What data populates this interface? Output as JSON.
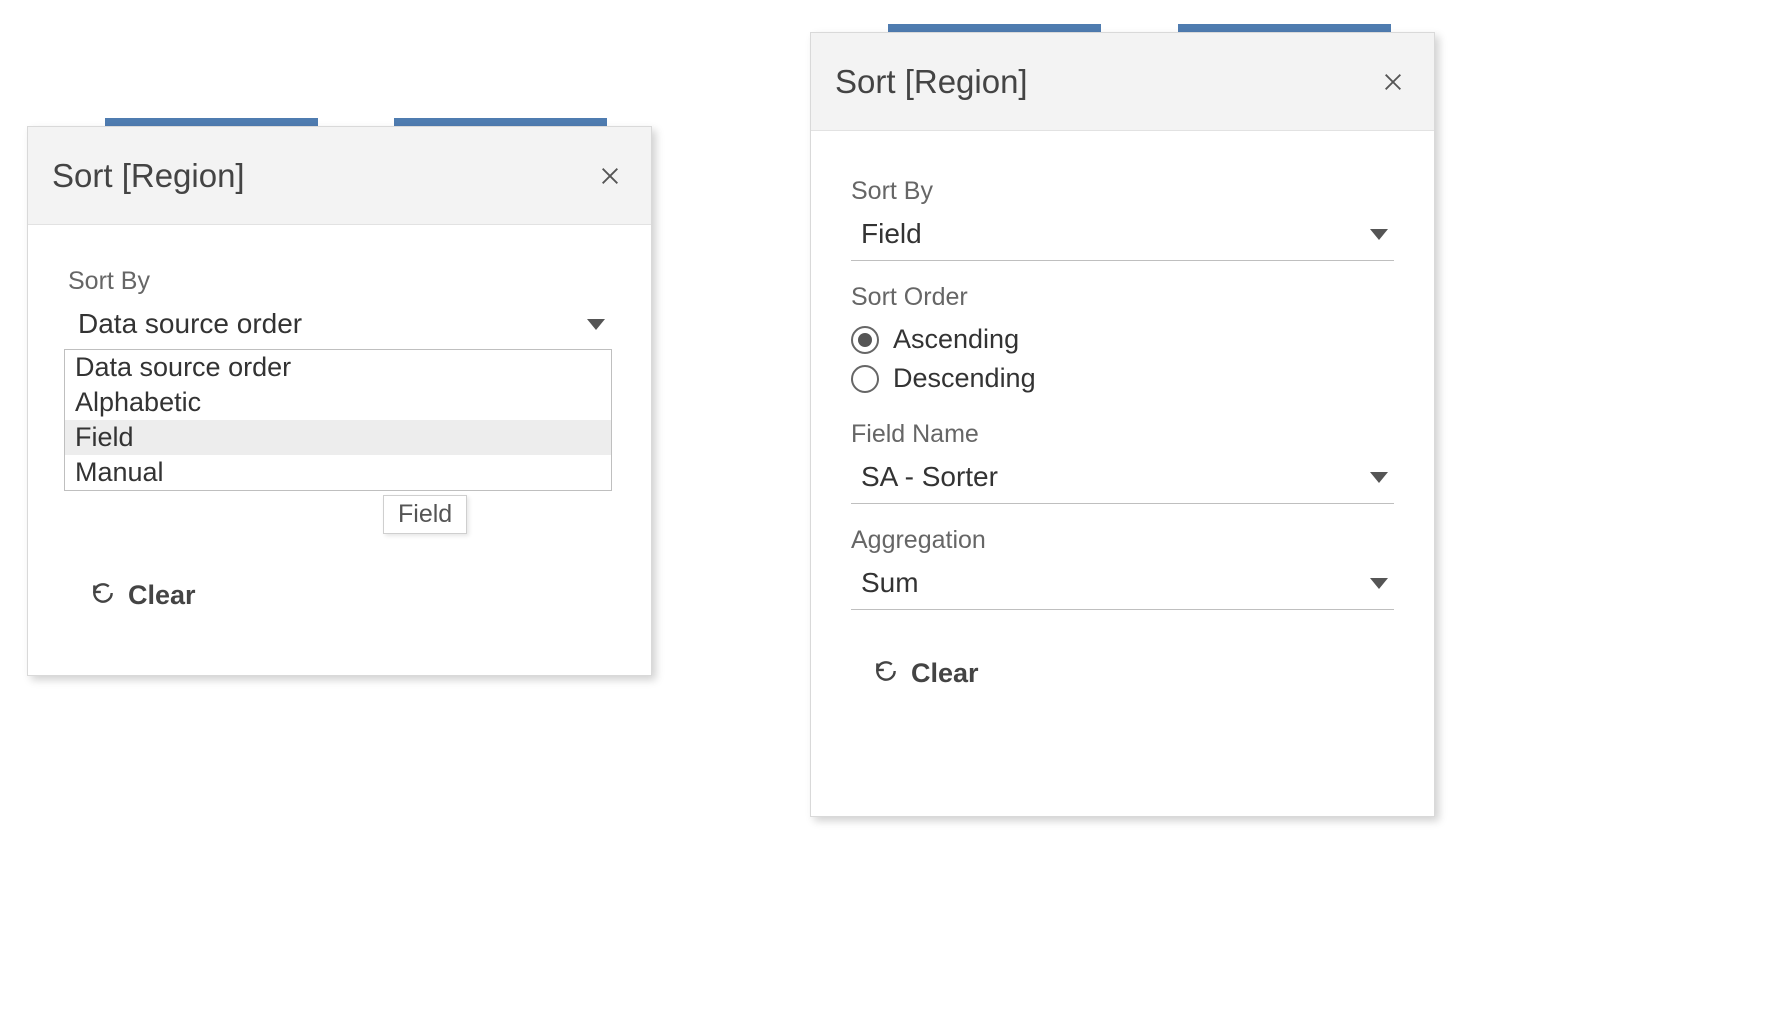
{
  "left_panel": {
    "title": "Sort [Region]",
    "sort_by_label": "Sort By",
    "sort_by_value": "Data source order",
    "dropdown_options": {
      "opt0": "Data source order",
      "opt1": "Alphabetic",
      "opt2": "Field",
      "opt3": "Manual"
    },
    "highlighted_option_index": 2,
    "tooltip": "Field",
    "clear_label": "Clear"
  },
  "right_panel": {
    "title": "Sort [Region]",
    "sort_by_label": "Sort By",
    "sort_by_value": "Field",
    "sort_order_label": "Sort Order",
    "sort_order_options": {
      "asc": "Ascending",
      "desc": "Descending"
    },
    "sort_order_selected": "asc",
    "field_name_label": "Field Name",
    "field_name_value": "SA - Sorter",
    "aggregation_label": "Aggregation",
    "aggregation_value": "Sum",
    "clear_label": "Clear"
  },
  "colors": {
    "blue_bar": "#4f7cb0",
    "red_bar": "#cb4b4a"
  }
}
